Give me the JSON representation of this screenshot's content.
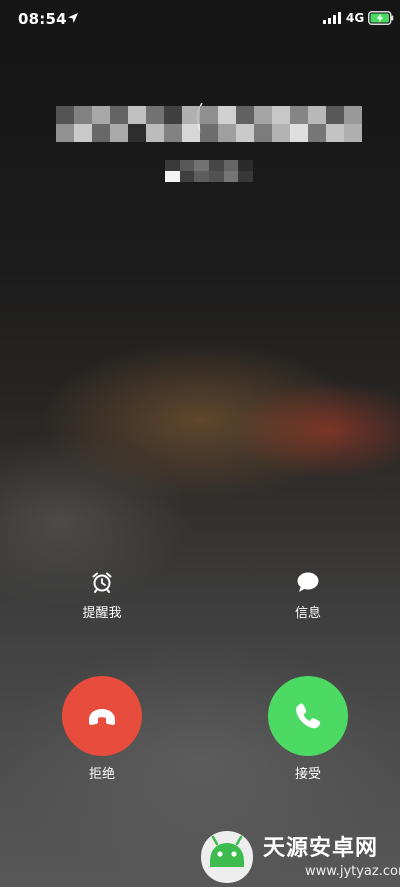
{
  "status_bar": {
    "time": "08:54",
    "location_icon": "location-arrow-icon",
    "signal_icon": "cellular-signal-icon",
    "network": "4G",
    "battery_icon": "battery-charging-icon",
    "battery_color": "#4cd964"
  },
  "caller": {
    "number_icon": "mosaic-redaction",
    "location_icon": "mosaic-redaction"
  },
  "actions": {
    "remind": {
      "label": "提醒我",
      "icon": "alarm-clock-icon"
    },
    "message": {
      "label": "信息",
      "icon": "message-bubble-icon"
    },
    "decline": {
      "label": "拒绝",
      "icon": "phone-hangup-icon",
      "color": "#e74c3c"
    },
    "accept": {
      "label": "接受",
      "icon": "phone-accept-icon",
      "color": "#4cd964"
    }
  },
  "watermark": {
    "title": "天源安卓网",
    "url": "www.jytyaz.com",
    "logo_icon": "android-logo-icon"
  }
}
